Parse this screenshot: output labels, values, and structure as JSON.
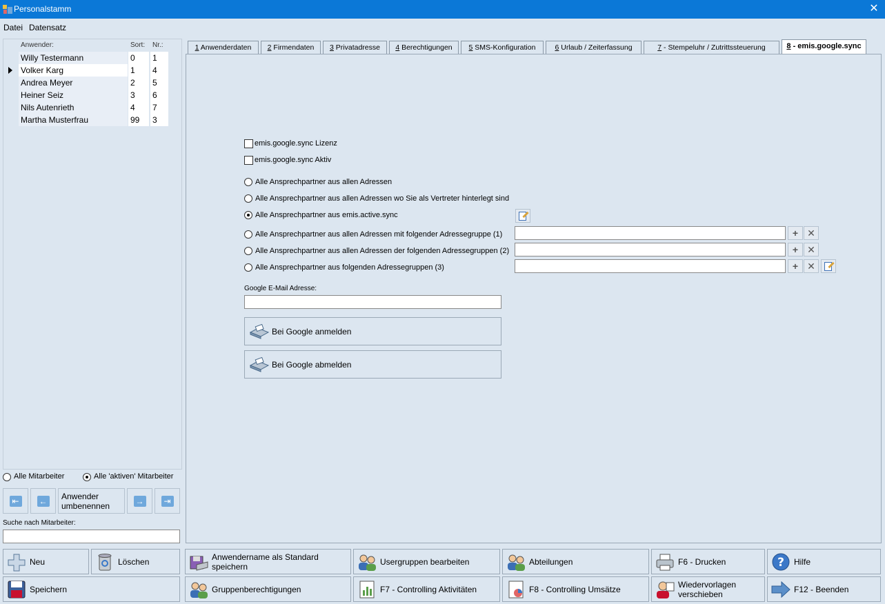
{
  "window": {
    "title": "Personalstamm",
    "close_label": "✕"
  },
  "menu": {
    "items": [
      "Datei",
      "Datensatz"
    ]
  },
  "list": {
    "headers": {
      "name": "Anwender:",
      "sort": "Sort:",
      "nr": "Nr.:"
    },
    "rows": [
      {
        "name": "Willy Testermann",
        "sort": "0",
        "nr": "1"
      },
      {
        "name": "Volker Karg",
        "sort": "1",
        "nr": "4"
      },
      {
        "name": "Andrea Meyer",
        "sort": "2",
        "nr": "5"
      },
      {
        "name": "Heiner Seiz",
        "sort": "3",
        "nr": "6"
      },
      {
        "name": "Nils Autenrieth",
        "sort": "4",
        "nr": "7"
      },
      {
        "name": "Martha Musterfrau",
        "sort": "99",
        "nr": "3"
      }
    ],
    "selected_index": 1
  },
  "filter": {
    "all_label": "Alle Mitarbeiter",
    "active_label": "Alle 'aktiven' Mitarbeiter",
    "selected": "active"
  },
  "nav": {
    "rename_label": "Anwender umbenennen"
  },
  "search": {
    "label": "Suche nach Mitarbeiter:",
    "value": ""
  },
  "tabs": [
    {
      "num": "1",
      "label": " Anwenderdaten"
    },
    {
      "num": "2",
      "label": " Firmendaten"
    },
    {
      "num": "3",
      "label": " Privatadresse"
    },
    {
      "num": "4",
      "label": " Berechtigungen"
    },
    {
      "num": "5",
      "label": " SMS-Konfiguration"
    },
    {
      "num": "6",
      "label": " Urlaub / Zeiterfassung"
    },
    {
      "num": "7",
      "label": " - Stempeluhr / Zutrittssteuerung"
    },
    {
      "num": "8",
      "label": " - emis.google.sync"
    }
  ],
  "sync": {
    "license_label": "emis.google.sync Lizenz",
    "active_label": "emis.google.sync Aktiv",
    "option1": "Alle Ansprechpartner aus allen Adressen",
    "option2": "Alle Ansprechpartner aus allen Adressen wo Sie als Vertreter hinterlegt sind",
    "option3": "Alle Ansprechpartner aus emis.active.sync",
    "option4": "Alle Ansprechpartner aus allen Adressen mit folgender Adressegruppe (1)",
    "option5": "Alle Ansprechpartner aus allen Adressen der folgenden Adressegruppen (2)",
    "option6": "Alle Ansprechpartner aus folgenden Adressegruppen (3)",
    "selected_option": 3,
    "group1_value": "",
    "group2_value": "",
    "group3_value": "",
    "email_label": "Google E-Mail Adresse:",
    "email_value": "",
    "login_label": "Bei Google anmelden",
    "logout_label": "Bei Google abmelden"
  },
  "toolbar": {
    "neu": "Neu",
    "loeschen": "Löschen",
    "standard": "Anwendername als Standard speichern",
    "usergruppen": "Usergruppen bearbeiten",
    "abteilungen": "Abteilungen",
    "drucken": "F6 - Drucken",
    "hilfe": "Hilfe",
    "speichern": "Speichern",
    "gruppenberechtigungen": "Gruppenberechtigungen",
    "controlling_akt": "F7 - Controlling Aktivitäten",
    "controlling_ums": "F8 - Controlling Umsätze",
    "wiedervorlagen": "Wiedervorlagen verschieben",
    "beenden": "F12 - Beenden"
  }
}
